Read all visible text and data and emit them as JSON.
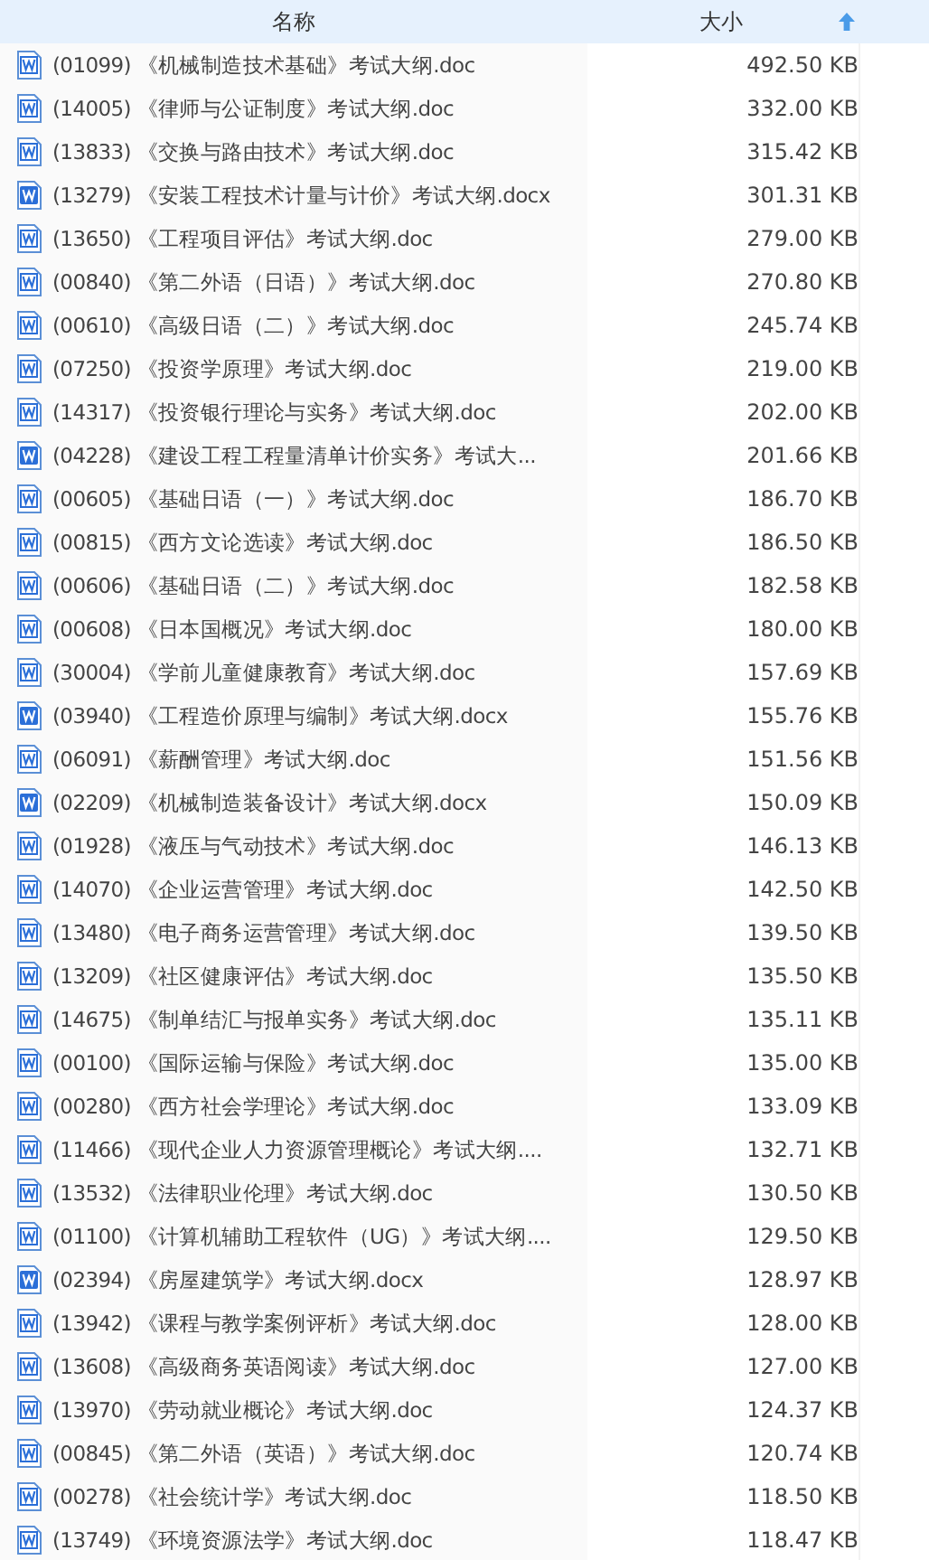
{
  "header": {
    "name_column": "名称",
    "size_column": "大小",
    "sort_ascending": true
  },
  "files": [
    {
      "name": "(01099) 《机械制造技术基础》考试大纲.doc",
      "size": "492.50 KB",
      "kind": "doc"
    },
    {
      "name": "(14005) 《律师与公证制度》考试大纲.doc",
      "size": "332.00 KB",
      "kind": "doc"
    },
    {
      "name": "(13833) 《交换与路由技术》考试大纲.doc",
      "size": "315.42 KB",
      "kind": "doc"
    },
    {
      "name": "(13279) 《安装工程技术计量与计价》考试大纲.docx",
      "size": "301.31 KB",
      "kind": "docx"
    },
    {
      "name": "(13650) 《工程项目评估》考试大纲.doc",
      "size": "279.00 KB",
      "kind": "doc"
    },
    {
      "name": "(00840) 《第二外语（日语）》考试大纲.doc",
      "size": "270.80 KB",
      "kind": "doc"
    },
    {
      "name": "(00610) 《高级日语（二）》考试大纲.doc",
      "size": "245.74 KB",
      "kind": "doc"
    },
    {
      "name": "(07250) 《投资学原理》考试大纲.doc",
      "size": "219.00 KB",
      "kind": "doc"
    },
    {
      "name": "(14317) 《投资银行理论与实务》考试大纲.doc",
      "size": "202.00 KB",
      "kind": "doc"
    },
    {
      "name": "(04228) 《建设工程工程量清单计价实务》考试大...",
      "size": "201.66 KB",
      "kind": "docx"
    },
    {
      "name": "(00605) 《基础日语（一）》考试大纲.doc",
      "size": "186.70 KB",
      "kind": "doc"
    },
    {
      "name": "(00815) 《西方文论选读》考试大纲.doc",
      "size": "186.50 KB",
      "kind": "doc"
    },
    {
      "name": "(00606) 《基础日语（二）》考试大纲.doc",
      "size": "182.58 KB",
      "kind": "doc"
    },
    {
      "name": "(00608) 《日本国概况》考试大纲.doc",
      "size": "180.00 KB",
      "kind": "doc"
    },
    {
      "name": "(30004) 《学前儿童健康教育》考试大纲.doc",
      "size": "157.69 KB",
      "kind": "doc"
    },
    {
      "name": "(03940) 《工程造价原理与编制》考试大纲.docx",
      "size": "155.76 KB",
      "kind": "docx"
    },
    {
      "name": "(06091) 《薪酬管理》考试大纲.doc",
      "size": "151.56 KB",
      "kind": "doc"
    },
    {
      "name": "(02209) 《机械制造装备设计》考试大纲.docx",
      "size": "150.09 KB",
      "kind": "docx"
    },
    {
      "name": "(01928) 《液压与气动技术》考试大纲.doc",
      "size": "146.13 KB",
      "kind": "doc"
    },
    {
      "name": "(14070) 《企业运营管理》考试大纲.doc",
      "size": "142.50 KB",
      "kind": "doc"
    },
    {
      "name": "(13480) 《电子商务运营管理》考试大纲.doc",
      "size": "139.50 KB",
      "kind": "doc"
    },
    {
      "name": "(13209) 《社区健康评估》考试大纲.doc",
      "size": "135.50 KB",
      "kind": "doc"
    },
    {
      "name": "(14675) 《制单结汇与报单实务》考试大纲.doc",
      "size": "135.11 KB",
      "kind": "doc"
    },
    {
      "name": "(00100) 《国际运输与保险》考试大纲.doc",
      "size": "135.00 KB",
      "kind": "doc"
    },
    {
      "name": "(00280) 《西方社会学理论》考试大纲.doc",
      "size": "133.09 KB",
      "kind": "doc"
    },
    {
      "name": "(11466) 《现代企业人力资源管理概论》考试大纲....",
      "size": "132.71 KB",
      "kind": "doc"
    },
    {
      "name": "(13532) 《法律职业伦理》考试大纲.doc",
      "size": "130.50 KB",
      "kind": "doc"
    },
    {
      "name": "(01100) 《计算机辅助工程软件（UG）》考试大纲....",
      "size": "129.50 KB",
      "kind": "doc"
    },
    {
      "name": "(02394) 《房屋建筑学》考试大纲.docx",
      "size": "128.97 KB",
      "kind": "docx"
    },
    {
      "name": "(13942) 《课程与教学案例评析》考试大纲.doc",
      "size": "128.00 KB",
      "kind": "doc"
    },
    {
      "name": "(13608) 《高级商务英语阅读》考试大纲.doc",
      "size": "127.00 KB",
      "kind": "doc"
    },
    {
      "name": "(13970) 《劳动就业概论》考试大纲.doc",
      "size": "124.37 KB",
      "kind": "doc"
    },
    {
      "name": "(00845) 《第二外语（英语）》考试大纲.doc",
      "size": "120.74 KB",
      "kind": "doc"
    },
    {
      "name": "(00278) 《社会统计学》考试大纲.doc",
      "size": "118.50 KB",
      "kind": "doc"
    },
    {
      "name": "(13749) 《环境资源法学》考试大纲.doc",
      "size": "118.47 KB",
      "kind": "doc"
    }
  ]
}
